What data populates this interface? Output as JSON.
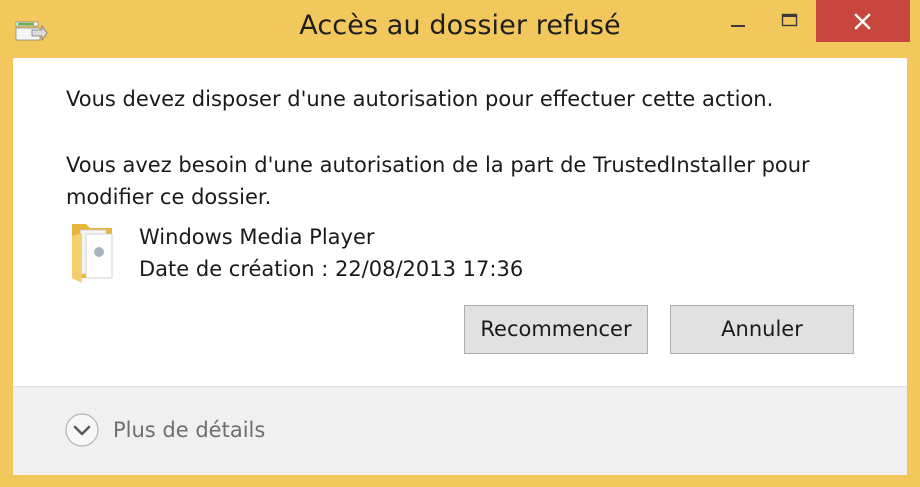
{
  "window": {
    "title": "Accès au dossier refusé",
    "frame_color": "#f2c85c",
    "close_color": "#c7463d"
  },
  "titlebar": {
    "app_icon": "folder-move-icon",
    "minimize_icon": "minimize-icon",
    "maximize_icon": "maximize-icon",
    "close_icon": "close-icon"
  },
  "message": {
    "line1": "Vous devez disposer d'une autorisation pour effectuer cette action.",
    "line2": "Vous avez besoin d'une autorisation de la part de TrustedInstaller pour modifier ce dossier."
  },
  "item": {
    "icon": "folder-icon",
    "name": "Windows Media Player",
    "date": "Date de création : 22/08/2013 17:36"
  },
  "buttons": {
    "retry": "Recommencer",
    "cancel": "Annuler"
  },
  "footer": {
    "expand_icon": "chevron-down-circle-icon",
    "details_label": "Plus de détails"
  }
}
